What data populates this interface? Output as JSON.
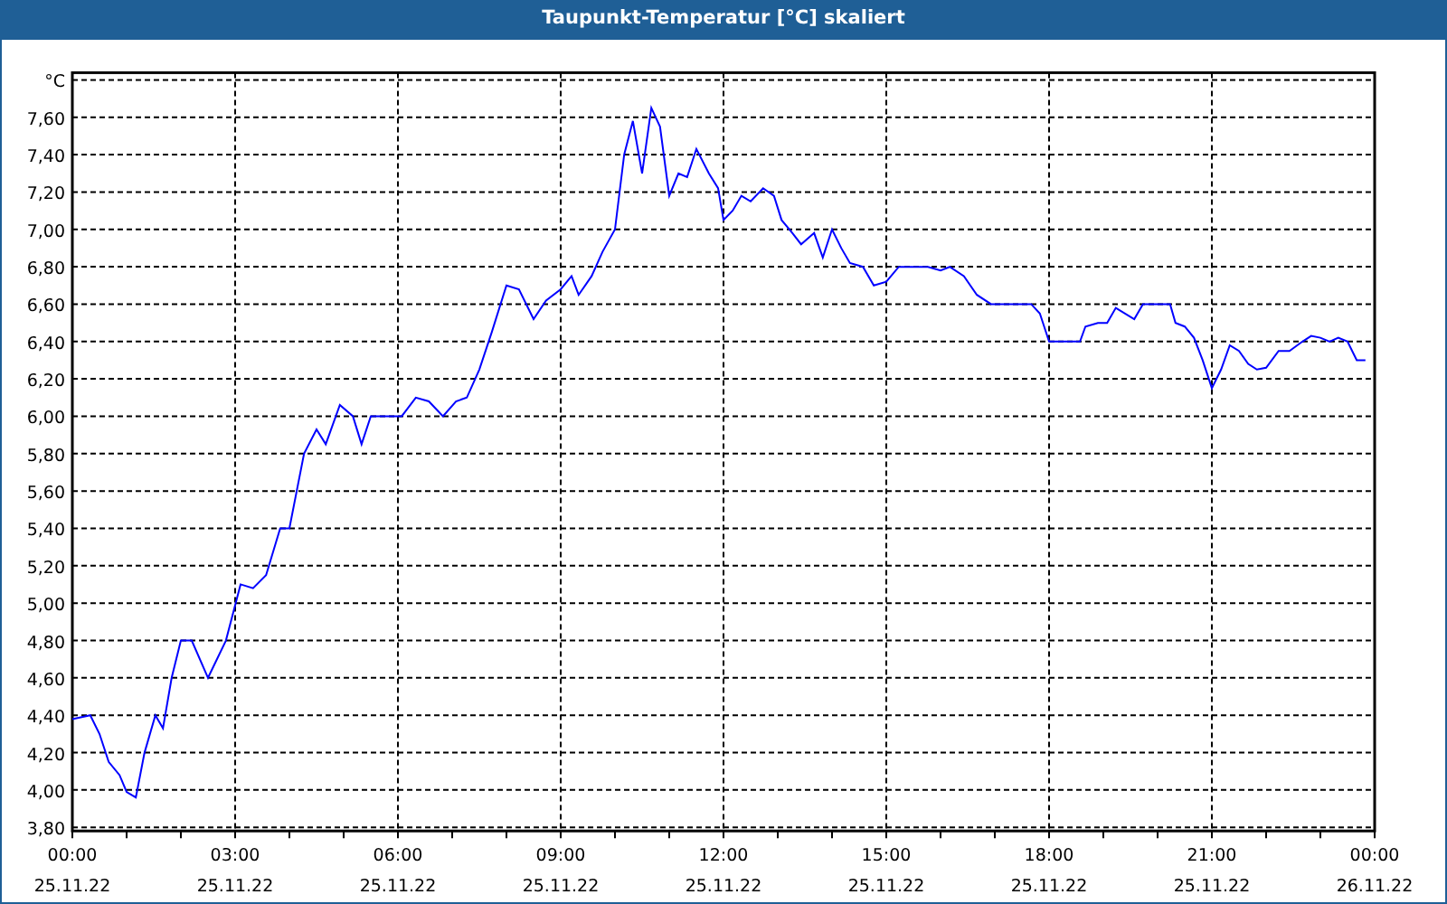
{
  "window": {
    "title": "Taupunkt-Temperatur [°C] skaliert"
  },
  "chart": {
    "chart_data": {
      "type": "line",
      "xlim": [
        0,
        24
      ],
      "ylim": [
        3.8,
        7.8
      ],
      "xticks": [
        {
          "value": 0,
          "label": "00:00"
        },
        {
          "value": 3,
          "label": "03:00"
        },
        {
          "value": 6,
          "label": "06:00"
        },
        {
          "value": 9,
          "label": "09:00"
        },
        {
          "value": 12,
          "label": "12:00"
        },
        {
          "value": 15,
          "label": "15:00"
        },
        {
          "value": 18,
          "label": "18:00"
        },
        {
          "value": 21,
          "label": "21:00"
        },
        {
          "value": 24,
          "label": "00:00"
        }
      ],
      "annotations": [
        "25.11.22",
        "25.11.22",
        "25.11.22",
        "25.11.22",
        "25.11.22",
        "25.11.22",
        "25.11.22",
        "25.11.22",
        "26.11.22"
      ],
      "grid": true,
      "yticks": [
        {
          "value": 3.8,
          "label": "3,80"
        },
        {
          "value": 4.0,
          "label": "4,00"
        },
        {
          "value": 4.2,
          "label": "4,20"
        },
        {
          "value": 4.4,
          "label": "4,40"
        },
        {
          "value": 4.6,
          "label": "4,60"
        },
        {
          "value": 4.8,
          "label": "4,80"
        },
        {
          "value": 5.0,
          "label": "5,00"
        },
        {
          "value": 5.2,
          "label": "5,20"
        },
        {
          "value": 5.4,
          "label": "5,40"
        },
        {
          "value": 5.6,
          "label": "5,60"
        },
        {
          "value": 5.8,
          "label": "5,80"
        },
        {
          "value": 6.0,
          "label": "6,00"
        },
        {
          "value": 6.2,
          "label": "6,20"
        },
        {
          "value": 6.4,
          "label": "6,40"
        },
        {
          "value": 6.6,
          "label": "6,60"
        },
        {
          "value": 6.8,
          "label": "6,80"
        },
        {
          "value": 7.0,
          "label": "7,00"
        },
        {
          "value": 7.2,
          "label": "7,20"
        },
        {
          "value": 7.4,
          "label": "7,40"
        },
        {
          "value": 7.6,
          "label": "7,60"
        },
        {
          "value": 7.8,
          "label": "°C"
        }
      ],
      "x": [
        0,
        0.33,
        0.5,
        0.67,
        0.87,
        1,
        1.17,
        1.33,
        1.53,
        1.67,
        1.83,
        2,
        2.2,
        2.5,
        2.83,
        3.1,
        3.33,
        3.57,
        3.83,
        4,
        4.27,
        4.5,
        4.67,
        4.93,
        5.17,
        5.33,
        5.5,
        5.83,
        6.07,
        6.33,
        6.57,
        6.83,
        7.07,
        7.27,
        7.5,
        7.73,
        8,
        8.23,
        8.5,
        8.73,
        9,
        9.2,
        9.33,
        9.57,
        9.77,
        10,
        10.17,
        10.33,
        10.5,
        10.67,
        10.83,
        11,
        11.17,
        11.33,
        11.5,
        11.73,
        11.9,
        12,
        12.17,
        12.33,
        12.5,
        12.73,
        12.93,
        13.07,
        13.27,
        13.43,
        13.67,
        13.83,
        14,
        14.17,
        14.33,
        14.57,
        14.77,
        15,
        15.23,
        15.5,
        15.77,
        16,
        16.17,
        16.43,
        16.67,
        16.93,
        17.33,
        17.67,
        17.83,
        18,
        18.33,
        18.57,
        18.67,
        18.9,
        19.07,
        19.23,
        19.4,
        19.57,
        19.73,
        20,
        20.23,
        20.33,
        20.5,
        20.67,
        20.83,
        21,
        21.17,
        21.33,
        21.5,
        21.67,
        21.83,
        22,
        22.23,
        22.43,
        22.67,
        22.83,
        23,
        23.17,
        23.33,
        23.5,
        23.67,
        23.83
      ],
      "series": [
        {
          "color": "#0000ff",
          "values": [
            4.38,
            4.4,
            4.3,
            4.15,
            4.08,
            3.99,
            3.96,
            4.2,
            4.4,
            4.33,
            4.6,
            4.8,
            4.8,
            4.6,
            4.8,
            5.1,
            5.08,
            5.15,
            5.4,
            5.4,
            5.8,
            5.93,
            5.85,
            6.06,
            6.0,
            5.85,
            6.0,
            6.0,
            6.0,
            6.1,
            6.08,
            6.0,
            6.08,
            6.1,
            6.25,
            6.45,
            6.7,
            6.68,
            6.52,
            6.62,
            6.68,
            6.75,
            6.65,
            6.75,
            6.88,
            7.0,
            7.4,
            7.58,
            7.3,
            7.65,
            7.55,
            7.18,
            7.3,
            7.28,
            7.43,
            7.3,
            7.22,
            7.05,
            7.1,
            7.18,
            7.15,
            7.22,
            7.18,
            7.05,
            6.98,
            6.92,
            6.98,
            6.85,
            7.0,
            6.9,
            6.82,
            6.8,
            6.7,
            6.72,
            6.8,
            6.8,
            6.8,
            6.78,
            6.8,
            6.75,
            6.65,
            6.6,
            6.6,
            6.6,
            6.55,
            6.4,
            6.4,
            6.4,
            6.48,
            6.5,
            6.5,
            6.58,
            6.55,
            6.52,
            6.6,
            6.6,
            6.6,
            6.5,
            6.48,
            6.42,
            6.3,
            6.15,
            6.25,
            6.38,
            6.35,
            6.28,
            6.25,
            6.26,
            6.35,
            6.35,
            6.4,
            6.43,
            6.42,
            6.4,
            6.42,
            6.4,
            6.3,
            6.3
          ]
        }
      ]
    }
  }
}
